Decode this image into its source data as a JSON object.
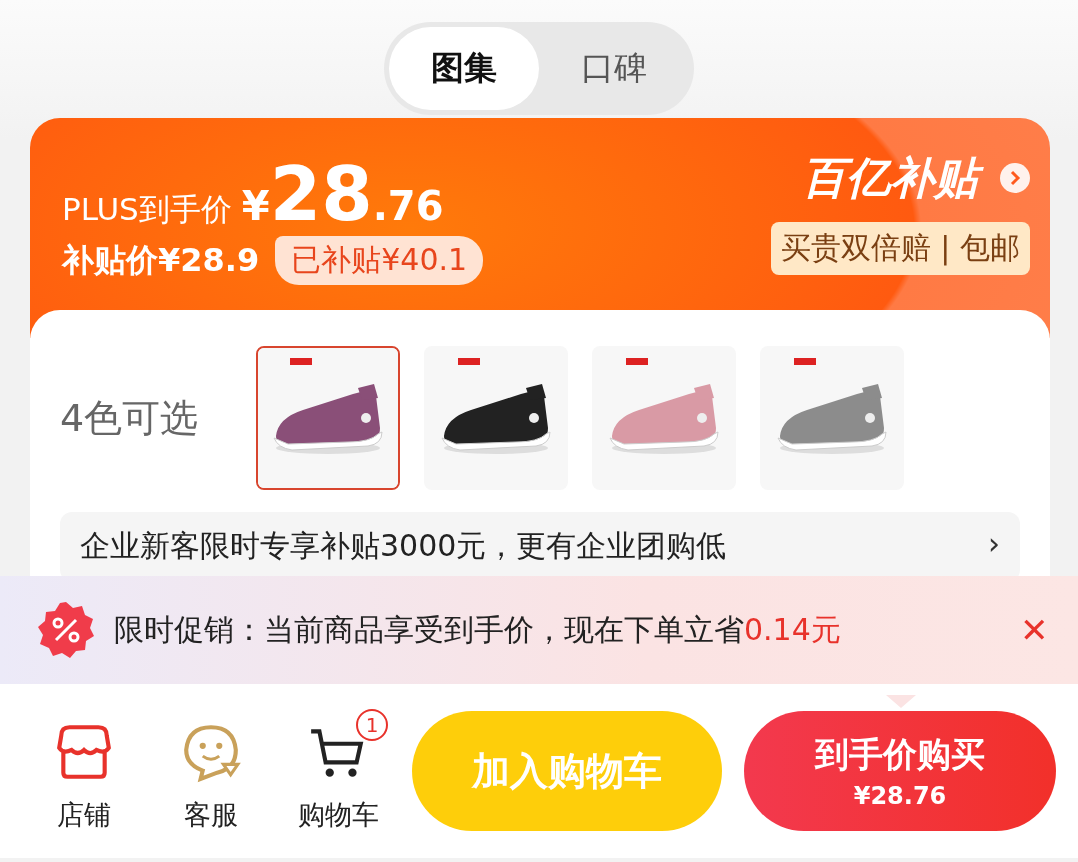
{
  "view_tabs": [
    {
      "label": "图集",
      "selected": true
    },
    {
      "label": "口碑",
      "selected": false
    }
  ],
  "price_banner": {
    "plus_label": "PLUS到手价",
    "currency": "¥",
    "price_int": "28",
    "price_dec": ".76",
    "subsidy_price": "补贴价¥28.9",
    "subsidy_tag": "已补贴¥40.1",
    "program_logo": "百亿补贴",
    "guarantee": "买贵双倍赔 | 包邮"
  },
  "color_options": {
    "label": "4色可选",
    "items": [
      {
        "kind": "picture",
        "color": "#8a4f78",
        "selected": true
      },
      {
        "kind": "picture",
        "color": "#222222",
        "selected": false
      },
      {
        "kind": "picture",
        "color": "#d99aa5",
        "selected": false
      },
      {
        "kind": "picture",
        "color": "#8c8c8c",
        "selected": false
      }
    ]
  },
  "enterprise_row": {
    "text": "企业新客限时专享补贴3000元，更有企业团购低",
    "chevron": "›"
  },
  "promo_bar": {
    "text": "限时促销：当前商品享受到手价，现在下单立省",
    "saving": "0.14元",
    "close": "✕"
  },
  "bottom_bar": {
    "nav": [
      {
        "kind": "store",
        "label": "店铺"
      },
      {
        "kind": "service",
        "label": "客服"
      },
      {
        "kind": "cart",
        "label": "购物车",
        "badge": "1"
      }
    ],
    "add_to_cart": "加入购物车",
    "buy": {
      "label": "到手价购买",
      "price": "¥28.76"
    }
  }
}
